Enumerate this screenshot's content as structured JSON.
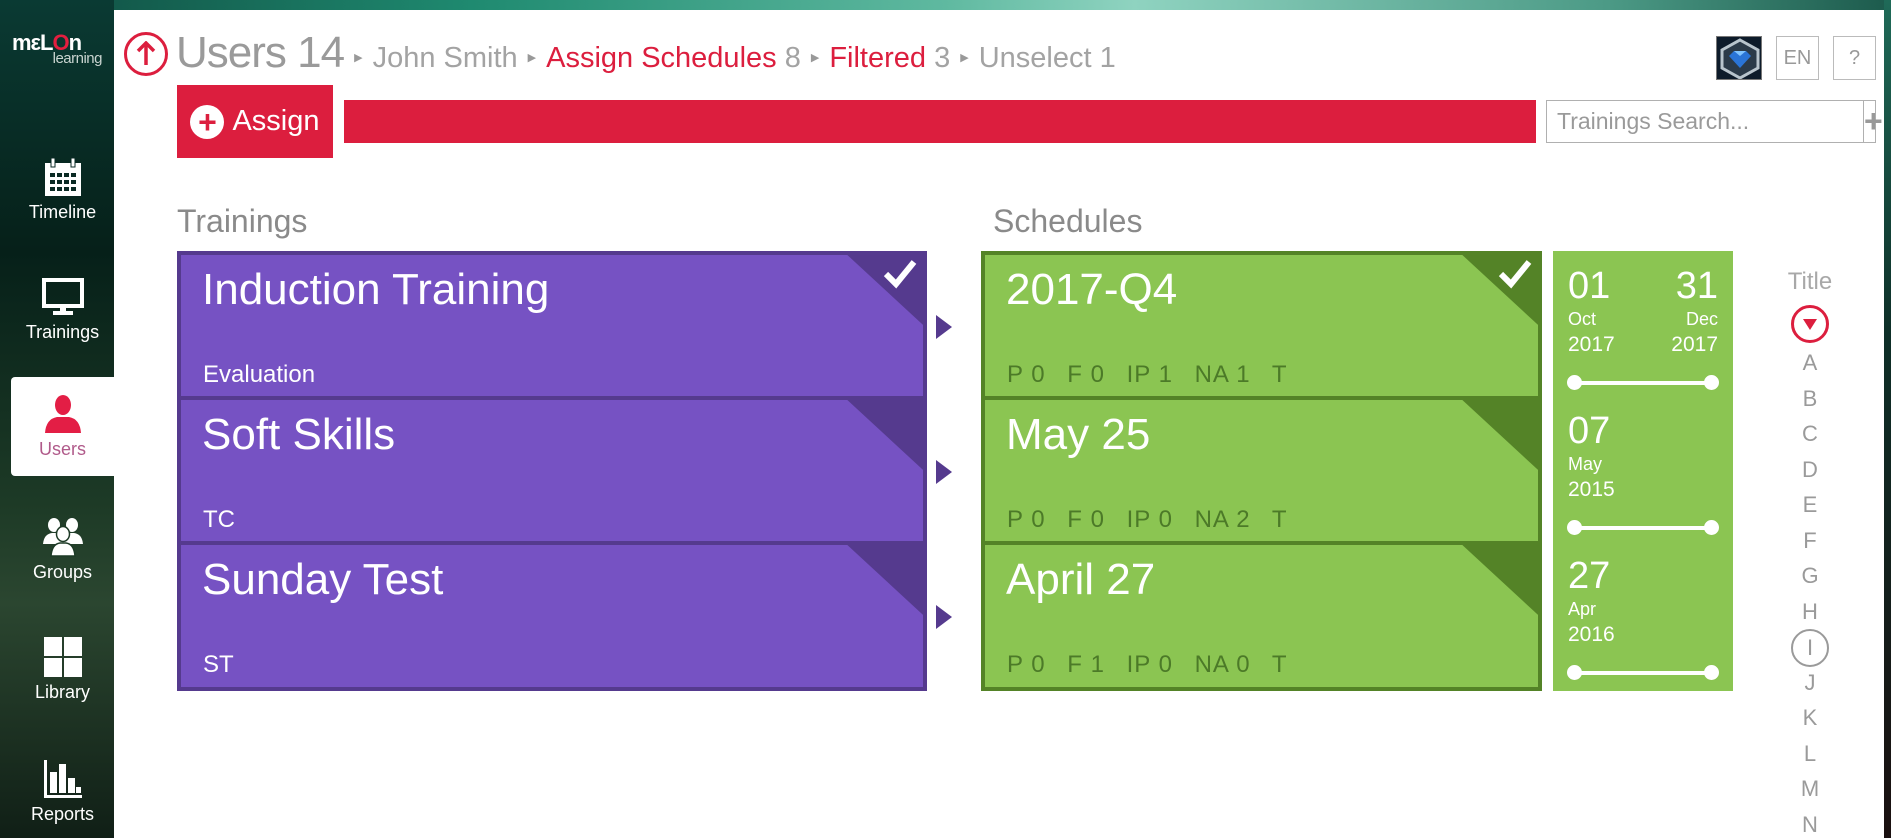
{
  "app": {
    "logo_main": "melon",
    "logo_sub": "learning"
  },
  "sidebar": {
    "items": [
      {
        "label": "Timeline",
        "icon": "calendar-icon",
        "active": false
      },
      {
        "label": "Trainings",
        "icon": "monitor-icon",
        "active": false
      },
      {
        "label": "Users",
        "icon": "user-icon",
        "active": true
      },
      {
        "label": "Groups",
        "icon": "group-icon",
        "active": false
      },
      {
        "label": "Library",
        "icon": "library-grid-icon",
        "active": false
      },
      {
        "label": "Reports",
        "icon": "bar-chart-icon",
        "active": false
      }
    ]
  },
  "breadcrumb": {
    "root_label": "Users",
    "root_count": "14",
    "items": [
      {
        "label": "John Smith",
        "count": ""
      },
      {
        "label": "Assign Schedules",
        "count": "8"
      },
      {
        "label": "Filtered",
        "count": "3"
      },
      {
        "label": "Unselect",
        "count": "1"
      }
    ]
  },
  "header": {
    "language": "EN",
    "help": "?"
  },
  "toolbar": {
    "assign_label": "Assign",
    "search_placeholder": "Trainings Search...",
    "add_symbol": "+"
  },
  "sections": {
    "trainings_title": "Trainings",
    "schedules_title": "Schedules"
  },
  "rows": [
    {
      "training": {
        "title": "Induction Training",
        "subtitle": "Evaluation",
        "selected": true
      },
      "schedule": {
        "title": "2017-Q4",
        "selected": true,
        "stats": {
          "P": "0",
          "F": "0",
          "IP": "1",
          "NA": "1",
          "T": ""
        },
        "start": {
          "day": "01",
          "month": "Oct",
          "year": "2017"
        },
        "end": {
          "day": "31",
          "month": "Dec",
          "year": "2017"
        }
      }
    },
    {
      "training": {
        "title": "Soft Skills",
        "subtitle": "TC",
        "selected": false
      },
      "schedule": {
        "title": "May 25",
        "selected": false,
        "stats": {
          "P": "0",
          "F": "0",
          "IP": "0",
          "NA": "2",
          "T": ""
        },
        "start": {
          "day": "07",
          "month": "May",
          "year": "2015"
        },
        "end": {
          "day": "",
          "month": "",
          "year": ""
        }
      }
    },
    {
      "training": {
        "title": "Sunday Test",
        "subtitle": "ST",
        "selected": false
      },
      "schedule": {
        "title": "April 27",
        "selected": false,
        "stats": {
          "P": "0",
          "F": "1",
          "IP": "0",
          "NA": "0",
          "T": ""
        },
        "start": {
          "day": "27",
          "month": "Apr",
          "year": "2016"
        },
        "end": {
          "day": "",
          "month": "",
          "year": ""
        }
      }
    }
  ],
  "alpha_index": {
    "title": "Title",
    "letters": [
      "A",
      "B",
      "C",
      "D",
      "E",
      "F",
      "G",
      "H",
      "I",
      "J",
      "K",
      "L",
      "M",
      "N"
    ],
    "selected": "I"
  },
  "colors": {
    "accent_red": "#dc1e3e",
    "training_purple": "#7652c3",
    "training_purple_dark": "#553a8e",
    "schedule_green": "#8bc552",
    "schedule_green_dark": "#548327"
  }
}
